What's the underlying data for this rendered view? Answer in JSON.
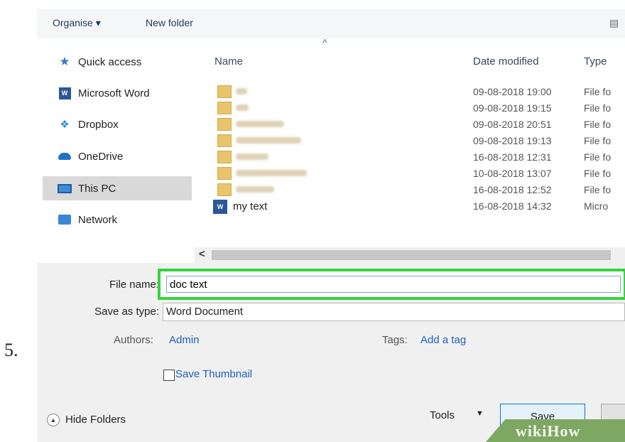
{
  "step_number": "5.",
  "toolbar": {
    "organise_label": "Organise ▾",
    "new_folder_label": "New folder"
  },
  "nav": {
    "items": [
      {
        "label": "Quick access",
        "icon": "star-icon"
      },
      {
        "label": "Microsoft Word",
        "icon": "word-icon"
      },
      {
        "label": "Dropbox",
        "icon": "dropbox-icon"
      },
      {
        "label": "OneDrive",
        "icon": "cloud-icon"
      },
      {
        "label": "This PC",
        "icon": "computer-icon",
        "selected": true
      },
      {
        "label": "Network",
        "icon": "network-icon"
      }
    ]
  },
  "file_list": {
    "columns": [
      "Name",
      "Date modified",
      "Type"
    ],
    "rows": [
      {
        "name": "",
        "date": "09-08-2018 19:00",
        "type": "File fo"
      },
      {
        "name": "",
        "date": "09-08-2018 19:15",
        "type": "File fo"
      },
      {
        "name": "",
        "date": "09-08-2018 20:51",
        "type": "File fo"
      },
      {
        "name": "",
        "date": "09-08-2018 19:13",
        "type": "File fo"
      },
      {
        "name": "",
        "date": "16-08-2018 12:31",
        "type": "File fo"
      },
      {
        "name": "",
        "date": "10-08-2018 13:07",
        "type": "File fo"
      },
      {
        "name": "",
        "date": "16-08-2018 12:52",
        "type": "File fo"
      },
      {
        "name": "my text",
        "date": "16-08-2018 14:32",
        "type": "Micro"
      }
    ]
  },
  "form": {
    "file_name_label": "File name:",
    "file_name_value": "doc text",
    "save_as_type_label": "Save as type:",
    "save_as_type_value": "Word Document",
    "authors_label": "Authors:",
    "authors_value": "Admin",
    "tags_label": "Tags:",
    "tags_value": "Add a tag",
    "save_thumbnail_label": "Save Thumbnail"
  },
  "footer": {
    "hide_folders_label": "Hide Folders",
    "tools_label": "Tools",
    "save_label": "Save"
  },
  "watermark": "wikiHow",
  "colors": {
    "highlight": "#37d23f",
    "link": "#1f5fbf",
    "folder": "#e8c46a"
  }
}
